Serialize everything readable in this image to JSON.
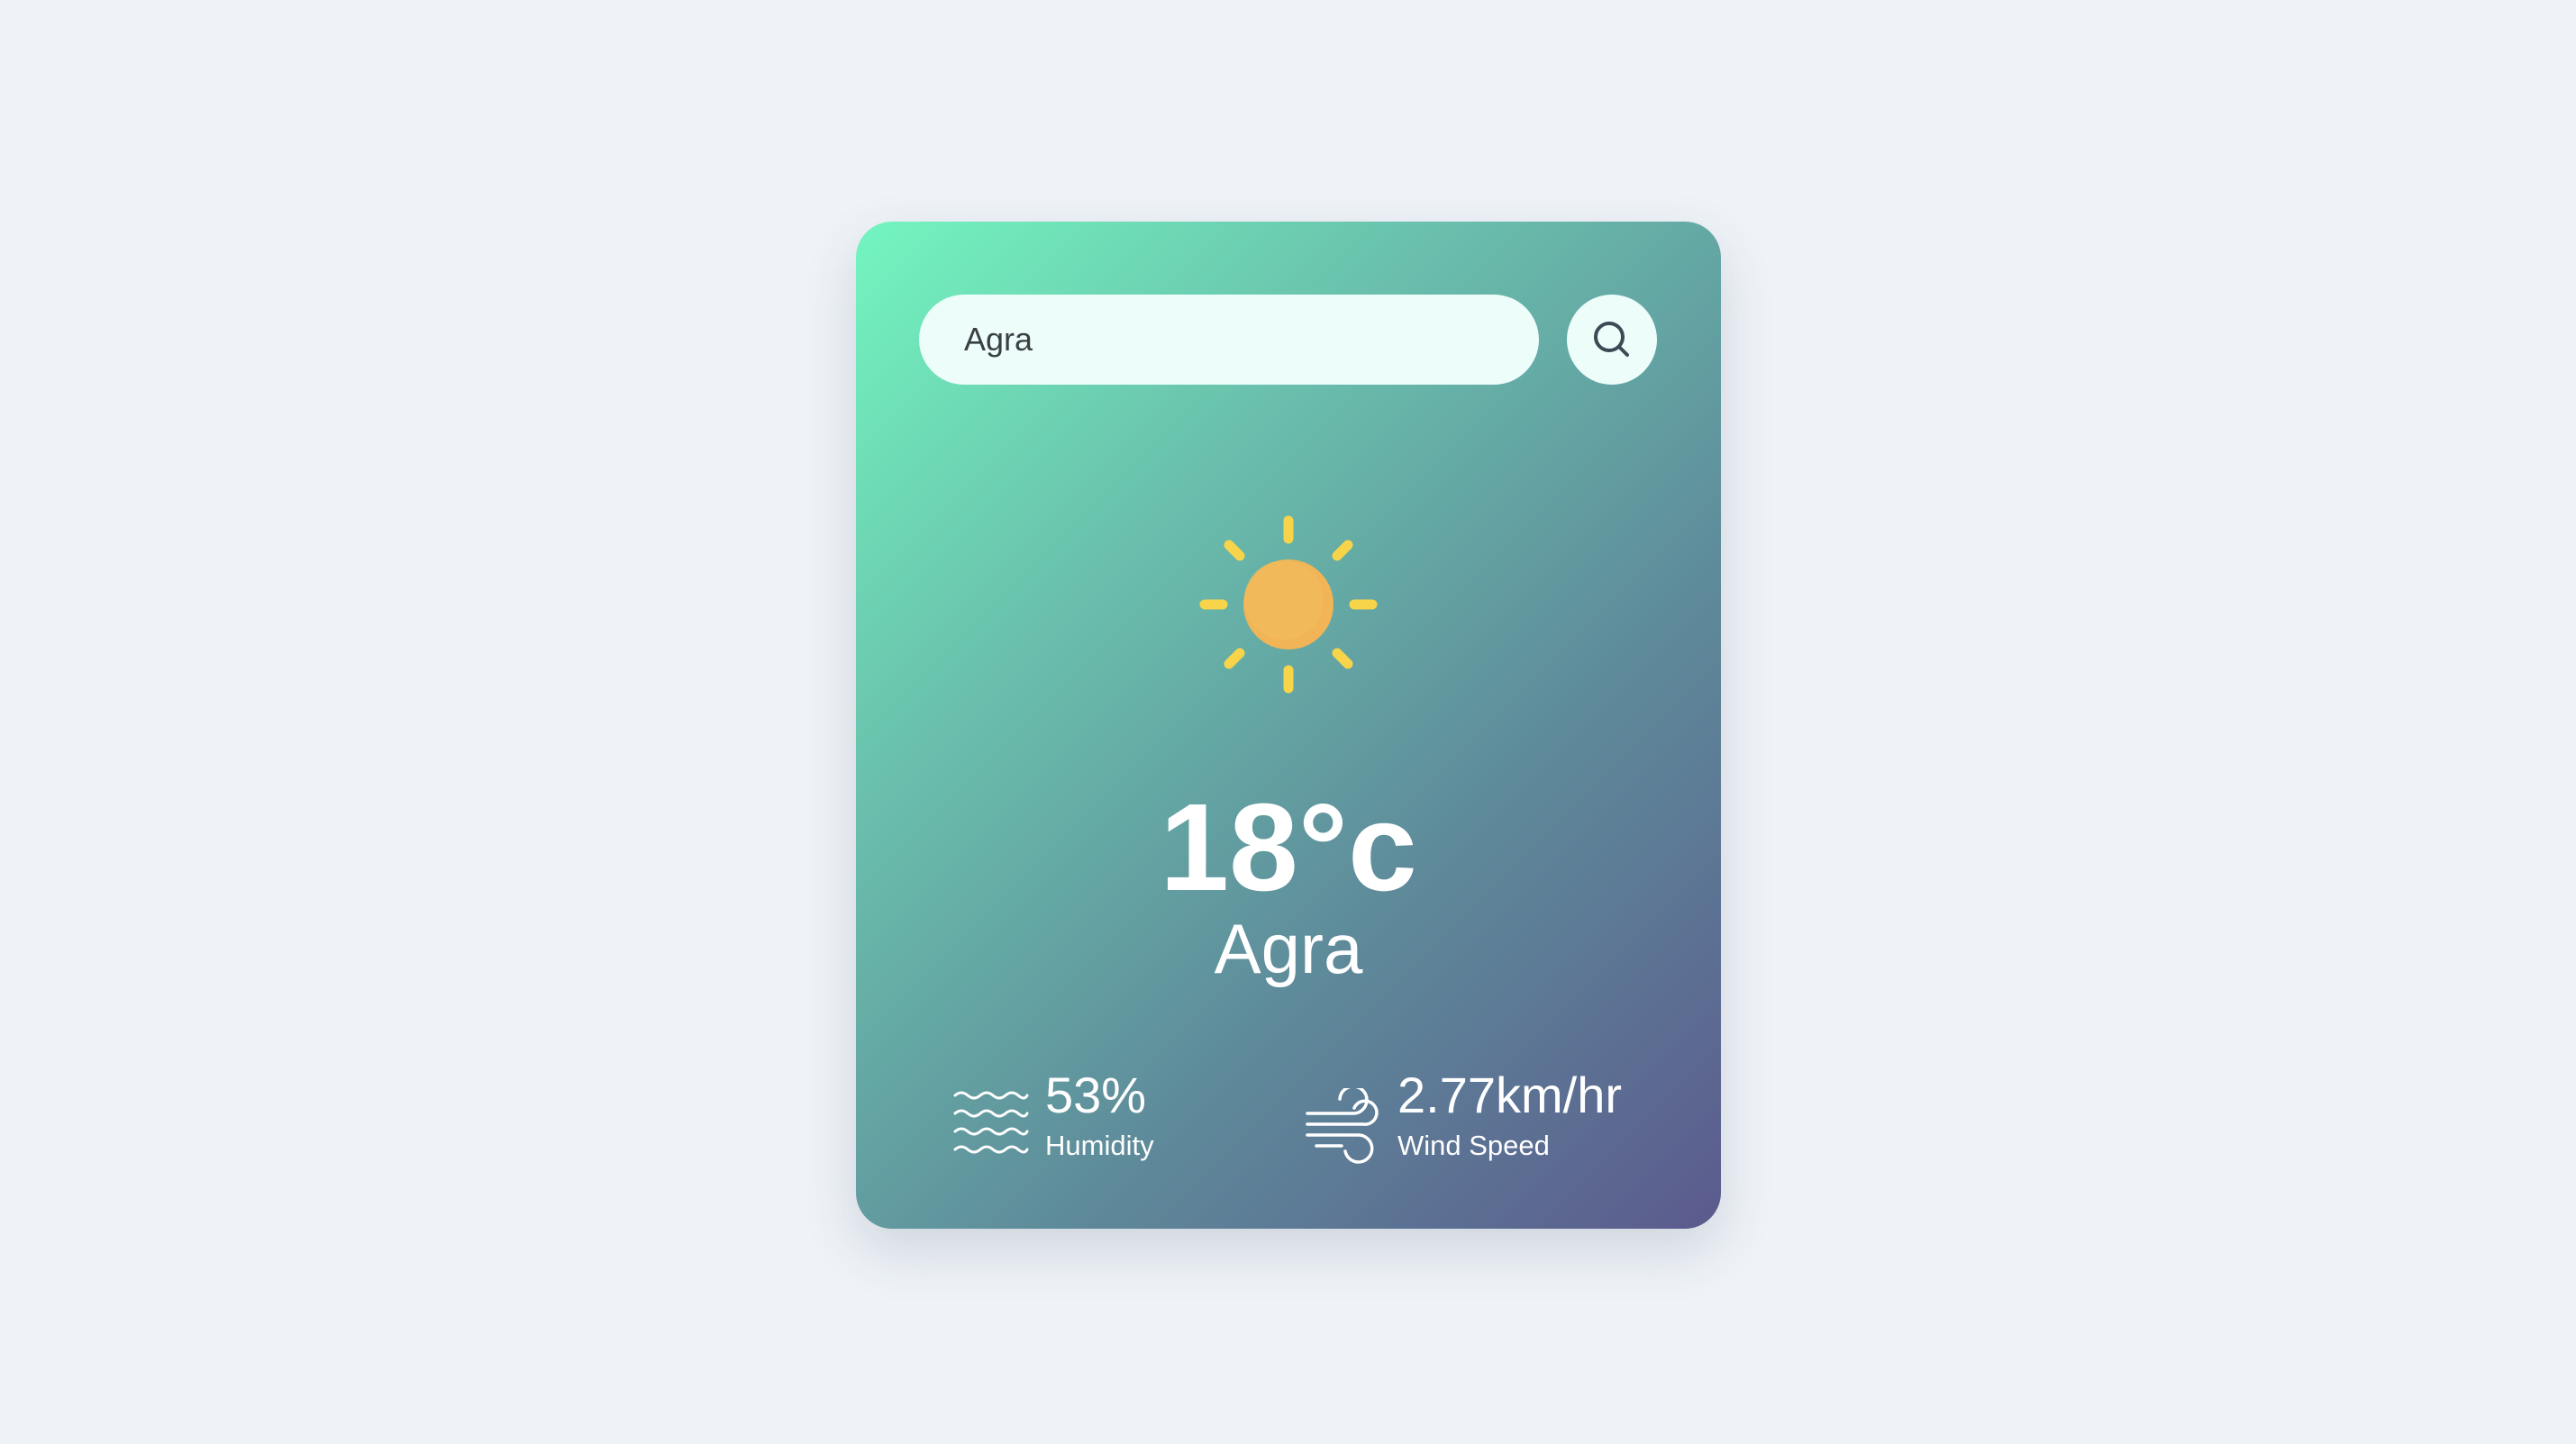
{
  "search": {
    "value": "Agra",
    "icon": "search-icon"
  },
  "weather": {
    "icon": "sun-icon",
    "temperature": "18°c",
    "city": "Agra"
  },
  "stats": {
    "humidity": {
      "icon": "humidity-waves-icon",
      "value": "53%",
      "label": "Humidity"
    },
    "wind": {
      "icon": "wind-icon",
      "value": "2.77km/hr",
      "label": "Wind Speed"
    }
  },
  "colors": {
    "background": "#eff3f8",
    "card_gradient_start": "#73f5bf",
    "card_gradient_end": "#5b5a8d",
    "input_background": "#ecfdfa",
    "sun_core": "#f1b456",
    "sun_rays": "#f7d44a",
    "text": "#ffffff"
  }
}
